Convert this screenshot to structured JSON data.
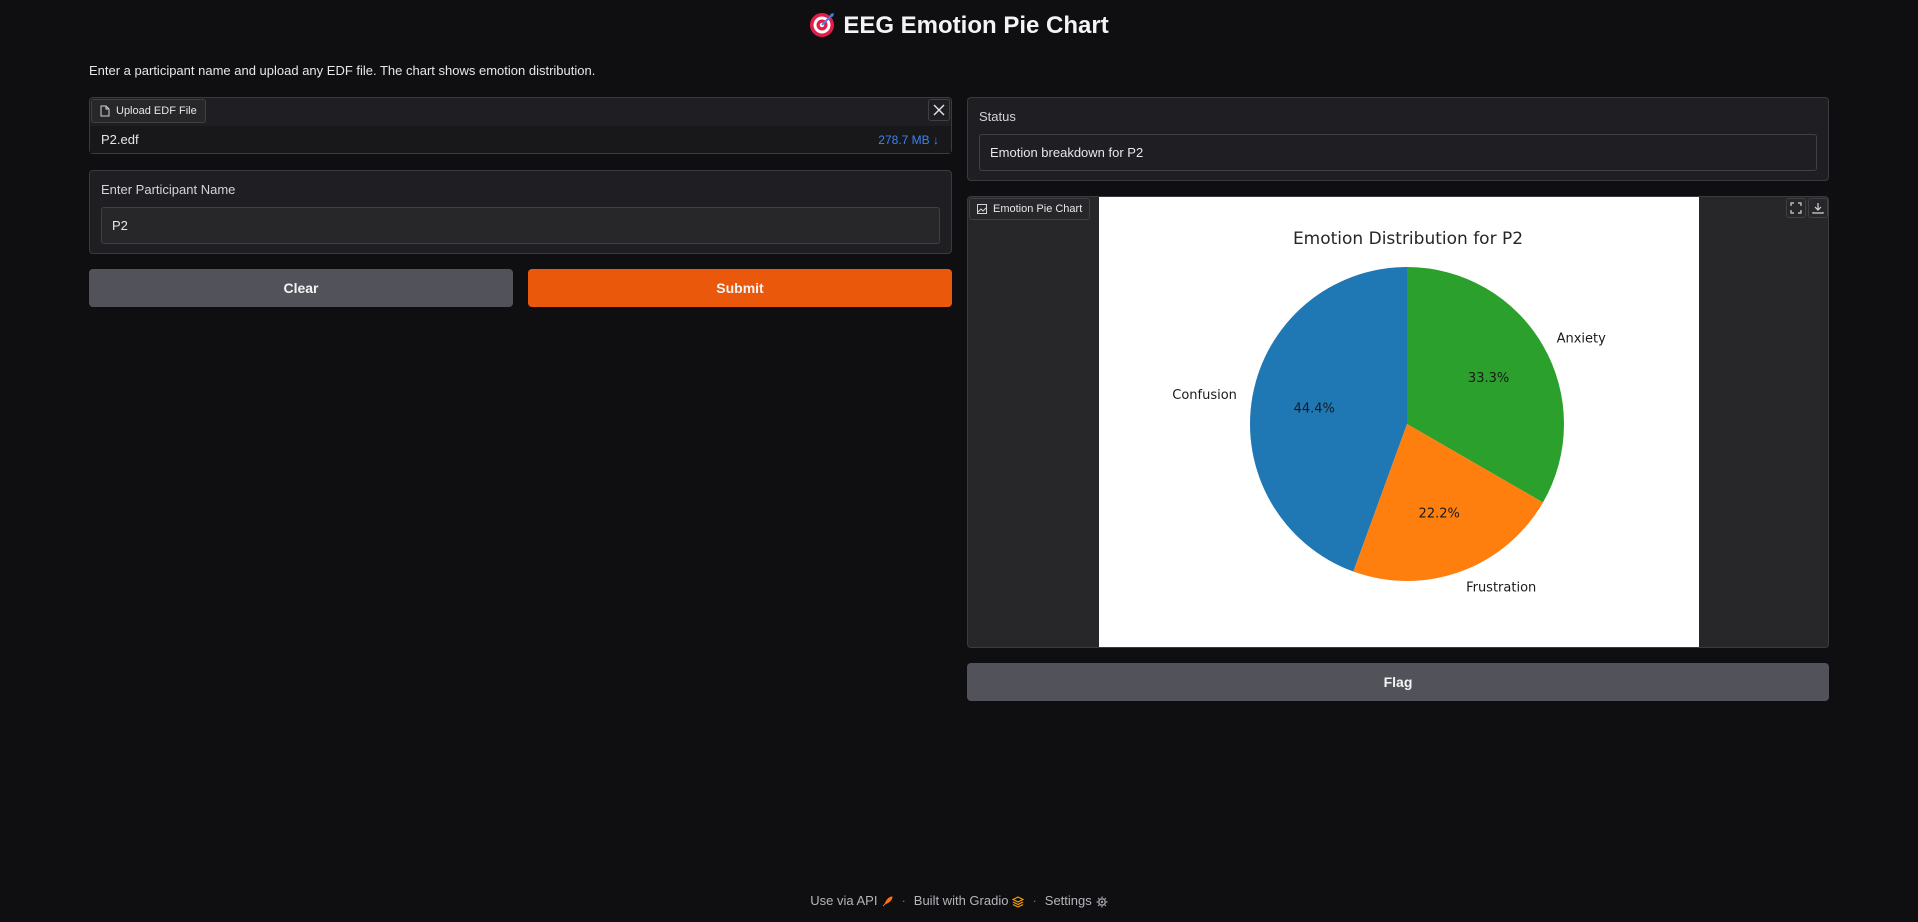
{
  "header": {
    "title": "EEG Emotion Pie Chart",
    "description": "Enter a participant name and upload any EDF file. The chart shows emotion distribution."
  },
  "upload": {
    "label": "Upload EDF File",
    "file_name": "P2.edf",
    "file_size": "278.7 MB ↓"
  },
  "participant": {
    "label": "Enter Participant Name",
    "value": "P2"
  },
  "buttons": {
    "clear": "Clear",
    "submit": "Submit",
    "flag": "Flag"
  },
  "status": {
    "label": "Status",
    "value": "Emotion breakdown for P2"
  },
  "chart_panel": {
    "label": "Emotion Pie Chart"
  },
  "chart_data": {
    "type": "pie",
    "title": "Emotion Distribution for P2",
    "slices": [
      {
        "label": "Anxiety",
        "value": 33.3,
        "pct_label": "33.3%",
        "color": "#2ca02c"
      },
      {
        "label": "Frustration",
        "value": 22.2,
        "pct_label": "22.2%",
        "color": "#ff7f0e"
      },
      {
        "label": "Confusion",
        "value": 44.4,
        "pct_label": "44.4%",
        "color": "#1f77b4"
      }
    ]
  },
  "footer": {
    "api": "Use via API",
    "built": "Built with Gradio",
    "settings": "Settings"
  },
  "colors": {
    "accent": "#ea580c",
    "secondary_button": "#52525b",
    "link": "#3b82f6"
  }
}
